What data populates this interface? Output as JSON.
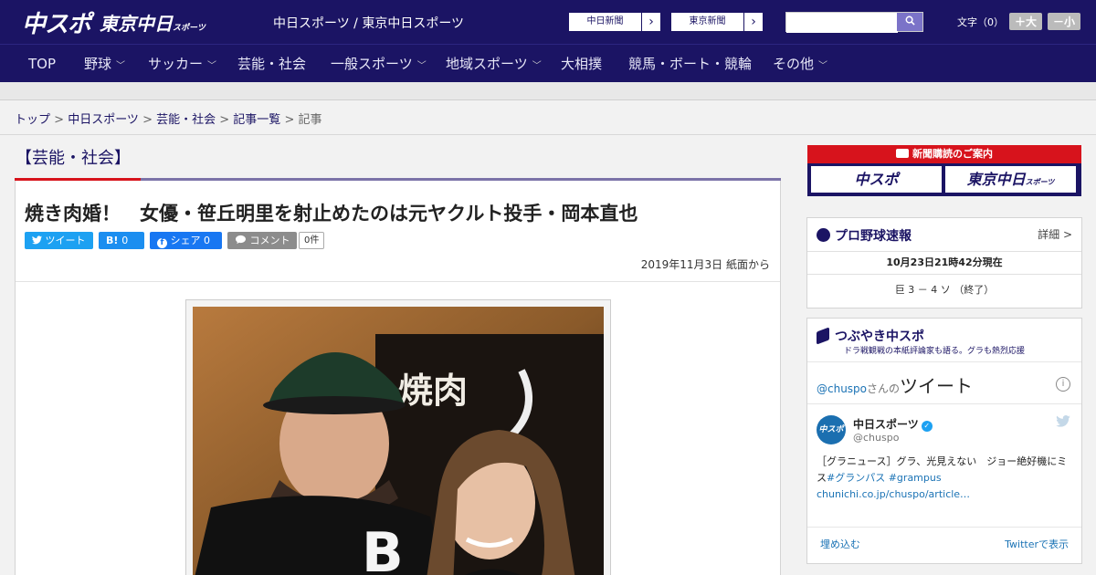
{
  "header": {
    "logo_main": "中スポ",
    "logo_sub": "東京中日",
    "logo_sub_small": "スポーツ",
    "site_names": "中日スポーツ / 東京中日スポーツ",
    "paper_buttons": [
      "中日新聞",
      "東京新聞"
    ],
    "search_placeholder": "",
    "font_size_label": "文字（0）",
    "font_bigger": "＋大",
    "font_smaller": "－小"
  },
  "nav": {
    "items": [
      "TOP",
      "野球",
      "サッカー",
      "芸能・社会",
      "一般スポーツ",
      "地域スポーツ",
      "大相撲",
      "競馬・ボート・競輪",
      "その他"
    ]
  },
  "breadcrumb": {
    "links": [
      "トップ",
      "中日スポーツ",
      "芸能・社会",
      "記事一覧"
    ],
    "current": "記事",
    "sep": " > "
  },
  "article": {
    "category": "【芸能・社会】",
    "headline": "焼き肉婚！　女優・笹丘明里を射止めたのは元ヤクルト投手・岡本直也",
    "share": {
      "tweet": "ツイート",
      "hatena": "B!",
      "hatena_count": "0",
      "facebook": "シェア",
      "facebook_count": "0",
      "comment": "コメント",
      "comment_count": "0件"
    },
    "date": "2019年11月3日 紙面から",
    "photo_sign": "焼肉"
  },
  "sidebar": {
    "subscription_title": "新聞購読のご案内",
    "sub_logo_1": "中スポ",
    "sub_logo_2": "東京中日",
    "sub_logo_2_small": "スポーツ",
    "baseball": {
      "title": "プロ野球速報",
      "detail": "詳細 >",
      "time": "10月23日21時42分現在",
      "score": "巨 3 － 4 ソ （終了）"
    },
    "twitter": {
      "title": "つぶやき中スポ",
      "subtitle": "ドラ戦観戦の本紙評論家も語る。グラも熱烈応援",
      "label_handle": "@chuspo",
      "label_suffix": "さんの",
      "label_big": "ツイート",
      "avatar_text": "中スポ",
      "name": "中日スポーツ",
      "handle": "@chuspo",
      "text_1": "［グラニュース］グラ、光見えない　ジョー絶好機にミス",
      "tag_1": "#グランパス",
      "tag_2": "#grampus",
      "link": "chunichi.co.jp/chuspo/article…",
      "embed": "埋め込む",
      "view": "Twitterで表示"
    }
  }
}
